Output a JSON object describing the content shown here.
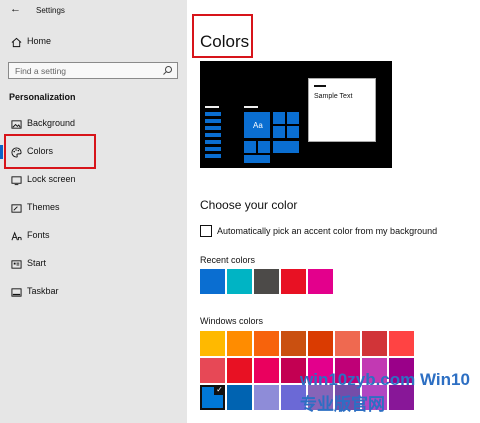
{
  "app": {
    "title": "Settings",
    "back_glyph": "←"
  },
  "sidebar": {
    "home": "Home",
    "search_placeholder": "Find a setting",
    "section": "Personalization",
    "items": [
      {
        "label": "Background",
        "icon": "picture-icon"
      },
      {
        "label": "Colors",
        "icon": "palette-icon",
        "selected": true
      },
      {
        "label": "Lock screen",
        "icon": "lock-screen-icon"
      },
      {
        "label": "Themes",
        "icon": "brush-icon"
      },
      {
        "label": "Fonts",
        "icon": "font-icon"
      },
      {
        "label": "Start",
        "icon": "start-icon"
      },
      {
        "label": "Taskbar",
        "icon": "taskbar-icon"
      }
    ]
  },
  "main": {
    "title": "Colors",
    "preview": {
      "tile_label": "Aa",
      "sample_text": "Sample Text"
    },
    "choose_heading": "Choose your color",
    "auto_accent": {
      "label": "Automatically pick an accent color from my background",
      "checked": false
    },
    "recent_label": "Recent colors",
    "windows_label": "Windows colors"
  },
  "colors": {
    "accent": "#0a6ed1",
    "highlight": "#d7141a",
    "recent": [
      "#0a6ed1",
      "#00b4c4",
      "#4c4a48",
      "#e81123",
      "#e3008c"
    ],
    "windows": [
      [
        "#ffb900",
        "#ff8c00",
        "#f7630c",
        "#ca5010",
        "#da3b01",
        "#ef6950",
        "#d13438",
        "#ff4343"
      ],
      [
        "#e74856",
        "#e81123",
        "#ea005e",
        "#c30052",
        "#e3008c",
        "#bf0077",
        "#c239b3",
        "#9a0089"
      ],
      [
        "#0078d7",
        "#0063b1",
        "#8e8cd8",
        "#6b69d6",
        "#8764b8",
        "#744da9",
        "#b146c2",
        "#881798"
      ]
    ],
    "selected_swatch_row": 2,
    "selected_swatch_col": 0
  },
  "watermark": "win10zyb.com Win10专业版官网"
}
